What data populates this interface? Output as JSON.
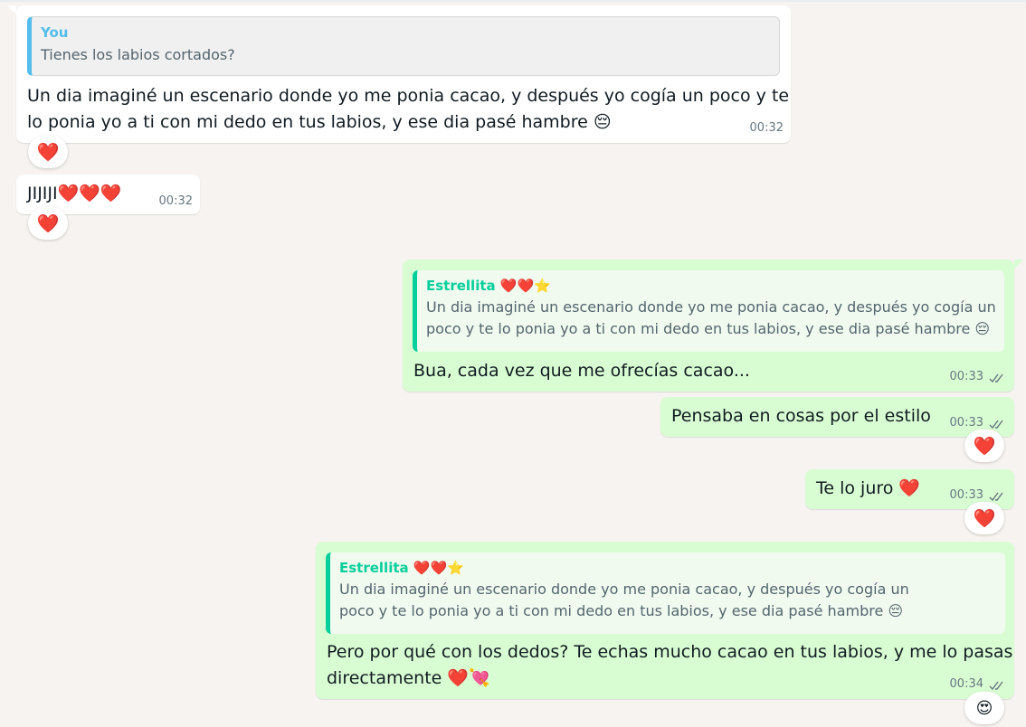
{
  "colors": {
    "chat_background": "#f6f3f0",
    "incoming_bubble": "#ffffff",
    "outgoing_bubble": "#d9fdd3",
    "quote_you_accent": "#53bdeb",
    "quote_contact_accent": "#06cf9c",
    "timestamp": "#667781",
    "read_ticks": "#667781",
    "heart": "#e31b23"
  },
  "messages": [
    {
      "direction": "incoming",
      "quote": {
        "author": "You",
        "text": "Tienes los labios cortados?"
      },
      "text_line1": "Un dia imaginé un escenario donde yo me ponia cacao, y después yo cogía un poco y te",
      "text_line2": "lo ponia yo a ti con mi dedo en tus labios, y ese dia pasé hambre 😔",
      "time": "00:32",
      "reaction": "❤️"
    },
    {
      "direction": "incoming",
      "text": "JIJIJI❤️❤️❤️",
      "time": "00:32",
      "reaction": "❤️"
    },
    {
      "direction": "outgoing",
      "quote": {
        "author": "Estrellita ❤️❤️⭐",
        "text_line1": "Un dia imaginé un escenario donde yo me ponia cacao, y después yo cogía un",
        "text_line2": "poco y te lo ponia yo a ti con mi dedo en tus labios, y ese dia pasé hambre 😔"
      },
      "text": "Bua, cada vez que me ofrecías cacao...",
      "time": "00:33",
      "status": "read-double-check-icon"
    },
    {
      "direction": "outgoing",
      "text": "Pensaba en cosas por el estilo",
      "time": "00:33",
      "status": "read-double-check-icon",
      "reaction": "❤️"
    },
    {
      "direction": "outgoing",
      "text": "Te lo juro ❤️",
      "time": "00:33",
      "status": "read-double-check-icon",
      "reaction": "❤️"
    },
    {
      "direction": "outgoing",
      "quote": {
        "author": "Estrellita ❤️❤️⭐",
        "text_line1": "Un dia imaginé un escenario donde yo me ponia cacao, y después yo cogía un",
        "text_line2": "poco y te lo ponia yo a ti con mi dedo en tus labios, y ese dia pasé hambre 😔"
      },
      "text_line1": "Pero por qué con los dedos? Te echas mucho cacao en tus labios, y me lo pasas",
      "text_line2": "directamente ❤️💘",
      "time": "00:34",
      "status": "read-double-check-icon",
      "reaction": "😍"
    }
  ]
}
